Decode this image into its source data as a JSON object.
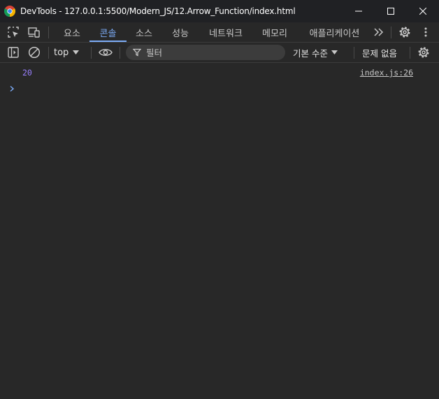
{
  "window": {
    "title": "DevTools - 127.0.0.1:5500/Modern_JS/12.Arrow_Function/index.html",
    "icon": "chrome-icon",
    "controls": [
      "minimize-icon",
      "maximize-icon",
      "close-icon"
    ]
  },
  "tabs": {
    "left_tools": [
      "inspect-element-icon",
      "device-toolbar-icon"
    ],
    "items": [
      {
        "label": "요소"
      },
      {
        "label": "콘솔"
      },
      {
        "label": "소스"
      },
      {
        "label": "성능"
      },
      {
        "label": "네트워크"
      },
      {
        "label": "메모리"
      },
      {
        "label": "애플리케이션"
      }
    ],
    "active": "콘솔",
    "more_icon": "more-tabs-icon",
    "settings_icon": "gear-icon",
    "menu_icon": "kebab-menu-icon"
  },
  "console_toolbar": {
    "sidebar_icon": "sidebar-toggle-icon",
    "clear_icon": "clear-console-icon",
    "context": "top",
    "eye_icon": "live-expression-icon",
    "filter_placeholder": "필터",
    "levels": "기본 수준",
    "issues": "문제 없음",
    "settings_icon": "gear-icon"
  },
  "console": {
    "messages": [
      {
        "value": "20",
        "source": "index.js:26"
      }
    ],
    "prompt_icon": "prompt-chevron-icon"
  },
  "colors": {
    "background": "#282828",
    "titlebar": "#202124",
    "accent": "#7cacf8",
    "number": "#9980ff"
  }
}
